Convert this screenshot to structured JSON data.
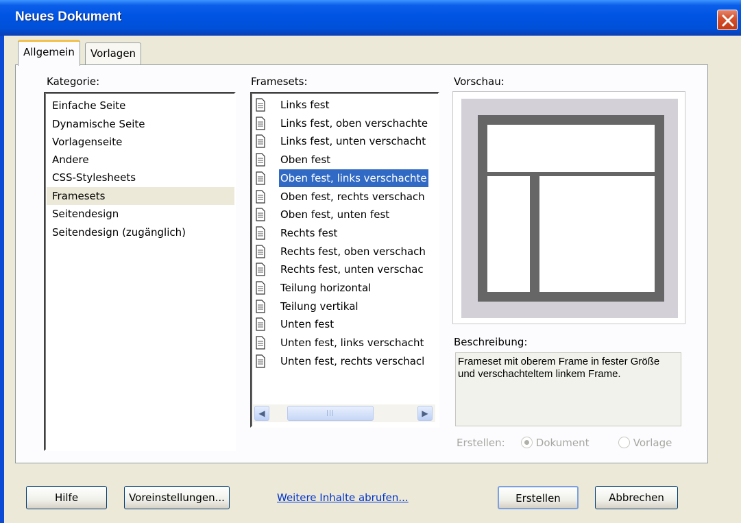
{
  "window": {
    "title": "Neues Dokument",
    "close_icon": "close-x-icon"
  },
  "tabs": [
    {
      "label": "Allgemein",
      "active": true
    },
    {
      "label": "Vorlagen",
      "active": false
    }
  ],
  "kategorie": {
    "label": "Kategorie:",
    "items": [
      "Einfache Seite",
      "Dynamische Seite",
      "Vorlagenseite",
      "Andere",
      "CSS-Stylesheets",
      "Framesets",
      "Seitendesign",
      "Seitendesign (zugänglich)"
    ],
    "selected": "Framesets"
  },
  "framesets": {
    "label": "Framesets:",
    "items": [
      "Links fest",
      "Links fest, oben verschachte",
      "Links fest, unten verschacht",
      "Oben fest",
      "Oben fest, links verschachte",
      "Oben fest, rechts verschach",
      "Oben fest, unten fest",
      "Rechts fest",
      "Rechts fest, oben verschach",
      "Rechts fest, unten verschac",
      "Teilung horizontal",
      "Teilung vertikal",
      "Unten fest",
      "Unten fest, links verschacht",
      "Unten fest, rechts verschacl"
    ],
    "selected": "Oben fest, links verschachte",
    "item_icon": "document-icon"
  },
  "vorschau": {
    "label": "Vorschau:"
  },
  "beschreibung": {
    "label": "Beschreibung:",
    "text": "Frameset mit oberem Frame in fester Größe und verschachteltem linkem Frame."
  },
  "erstellen": {
    "label": "Erstellen:",
    "options": [
      "Dokument",
      "Vorlage"
    ],
    "selected": "Dokument"
  },
  "buttons": {
    "hilfe": "Hilfe",
    "voreinstellungen": "Voreinstellungen...",
    "weitere": "Weitere Inhalte abrufen...",
    "erstellen": "Erstellen",
    "abbrechen": "Abbrechen"
  },
  "colors": {
    "titlebar": "#0054e3",
    "selection": "#316ac5",
    "link": "#0033cc"
  }
}
